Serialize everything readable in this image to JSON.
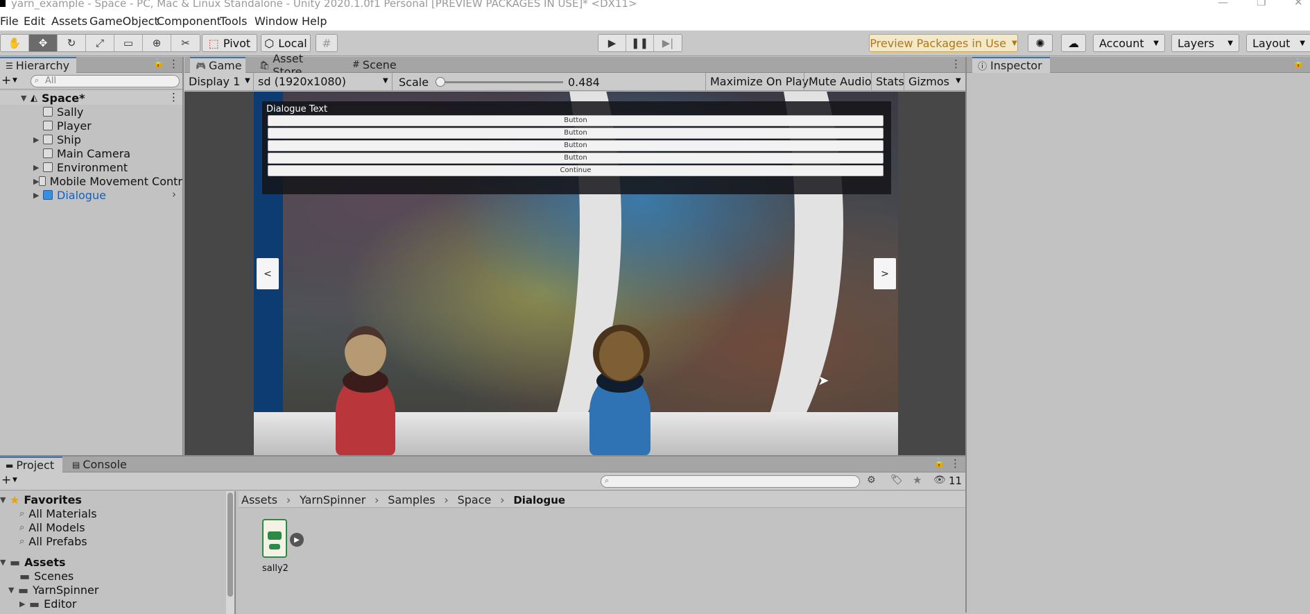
{
  "window": {
    "title": "yarn_example - Space - PC, Mac & Linux Standalone - Unity 2020.1.0f1 Personal [PREVIEW PACKAGES IN USE]* <DX11>"
  },
  "menu": [
    "File",
    "Edit",
    "Assets",
    "GameObject",
    "Component",
    "Tools",
    "Window",
    "Help"
  ],
  "toolbar": {
    "pivot_label": "Pivot",
    "local_label": "Local",
    "preview_packages_label": "Preview Packages in Use",
    "account_label": "Account",
    "layers_label": "Layers",
    "layout_label": "Layout"
  },
  "hierarchy": {
    "tab_label": "Hierarchy",
    "search_placeholder": "All",
    "scene_name": "Space*",
    "items": [
      {
        "label": "Sally",
        "expandable": false,
        "selected": false
      },
      {
        "label": "Player",
        "expandable": false,
        "selected": false
      },
      {
        "label": "Ship",
        "expandable": true,
        "selected": false
      },
      {
        "label": "Main Camera",
        "expandable": false,
        "selected": false
      },
      {
        "label": "Environment",
        "expandable": true,
        "selected": false
      },
      {
        "label": "Mobile Movement Contr",
        "expandable": true,
        "selected": false
      },
      {
        "label": "Dialogue",
        "expandable": true,
        "selected": true
      }
    ]
  },
  "center_tabs": {
    "game": "Game",
    "asset_store": "Asset Store",
    "scene": "Scene"
  },
  "game_bar": {
    "display": "Display 1",
    "resolution": "sd (1920x1080)",
    "scale_label": "Scale",
    "scale_value": "0.484",
    "scale_fraction": 0.0,
    "maximize": "Maximize On Play",
    "mute": "Mute Audio",
    "stats": "Stats",
    "gizmos": "Gizmos"
  },
  "game_ui": {
    "dialogue_text": "Dialogue Text",
    "option_buttons": [
      "Button",
      "Button",
      "Button",
      "Button"
    ],
    "continue_label": "Continue",
    "prev_label": "<",
    "next_label": ">"
  },
  "inspector": {
    "tab_label": "Inspector"
  },
  "bottom_tabs": {
    "project": "Project",
    "console": "Console",
    "hidden_count": "11"
  },
  "project_tree": {
    "favorites_label": "Favorites",
    "favorites": [
      "All Materials",
      "All Models",
      "All Prefabs"
    ],
    "assets_label": "Assets",
    "assets": [
      "Scenes",
      "YarnSpinner",
      "Editor"
    ]
  },
  "breadcrumb": [
    "Assets",
    "YarnSpinner",
    "Samples",
    "Space",
    "Dialogue"
  ],
  "assets_grid": [
    {
      "name": "sally2",
      "icon": "yarn-script-icon"
    }
  ]
}
